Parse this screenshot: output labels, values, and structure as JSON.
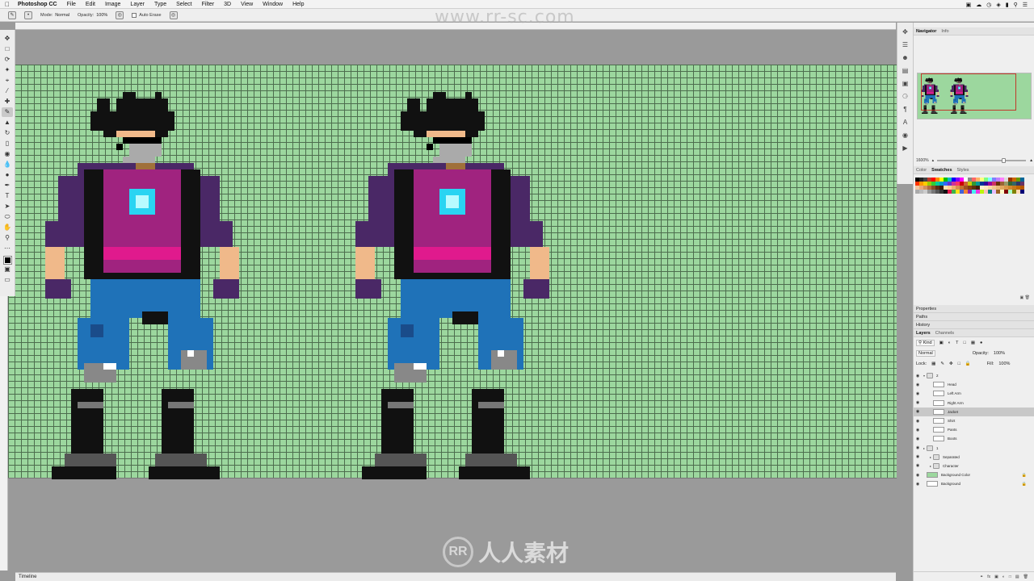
{
  "menubar": {
    "app_name": "Photoshop CC",
    "items": [
      "File",
      "Edit",
      "Image",
      "Layer",
      "Type",
      "Select",
      "Filter",
      "3D",
      "View",
      "Window",
      "Help"
    ]
  },
  "optionsbar": {
    "mode_label": "Mode:",
    "mode_value": "Normal",
    "opacity_label": "Opacity:",
    "opacity_value": "100%",
    "auto_erase_label": "Auto Erase"
  },
  "watermark": {
    "url": "www.rr-sc.com",
    "logo_text": "人人素材"
  },
  "timeline": {
    "label": "Timeline"
  },
  "navigator": {
    "tabs": [
      "Navigator",
      "Info"
    ],
    "zoom_value": "1600%"
  },
  "color_panel": {
    "tabs": [
      "Color",
      "Swatches",
      "Styles"
    ],
    "swatches": [
      "#000000",
      "#222222",
      "#444444",
      "#c0392b",
      "#ff0000",
      "#ff8800",
      "#ffff00",
      "#00c000",
      "#00c0c0",
      "#0000ff",
      "#8000ff",
      "#ff00ff",
      "#ffffff",
      "#888888",
      "#ff6666",
      "#ffb366",
      "#ffff80",
      "#80ff80",
      "#80ffff",
      "#8080ff",
      "#c080ff",
      "#ff80ff",
      "#dddddd",
      "#993300",
      "#cc6600",
      "#669900",
      "#006699",
      "#ff3300",
      "#ff9900",
      "#ffcc00",
      "#99cc00",
      "#33cc33",
      "#00cc99",
      "#0099cc",
      "#3366ff",
      "#6633cc",
      "#cc3399",
      "#ff3366",
      "#cc0000",
      "#cc6633",
      "#cccc00",
      "#339933",
      "#009999",
      "#003399",
      "#330099",
      "#990099",
      "#cc3366",
      "#663300",
      "#996633",
      "#999966",
      "#336633",
      "#336666",
      "#333366",
      "#663366",
      "#f2c6a0",
      "#e8a87c",
      "#d2905f",
      "#b36b3e",
      "#8a4a26",
      "#5c2e14",
      "#3b1a08",
      "#ffe0b0",
      "#ffd090",
      "#f0b070",
      "#d89050",
      "#c07030",
      "#a05020",
      "#804010",
      "#603010",
      "#402008",
      "#fff0d0",
      "#ffe8c0",
      "#f8d8a8",
      "#f0c890",
      "#e8b878",
      "#e0a860",
      "#d89848",
      "#d08830",
      "#c87818",
      "#c06800",
      "#b85800",
      "#aaaaaa",
      "#bbbbbb",
      "#cccccc",
      "#999999",
      "#777777",
      "#555555",
      "#333333",
      "#111111",
      "#e6194b",
      "#3cb44b",
      "#ffe119",
      "#4363d8",
      "#f58231",
      "#911eb4",
      "#46f0f0",
      "#f032e6",
      "#bcf60c",
      "#fabebe",
      "#008080",
      "#e6beff",
      "#9a6324",
      "#fffac8",
      "#800000",
      "#aaffc3",
      "#808000",
      "#ffd8b1",
      "#000075"
    ]
  },
  "collapsed_panels": [
    "Properties",
    "Paths",
    "History"
  ],
  "layers_panel": {
    "tabs": [
      "Layers",
      "Channels"
    ],
    "kind_label": "Kind",
    "blend_mode": "Normal",
    "opacity_label": "Opacity:",
    "opacity_value": "100%",
    "lock_label": "Lock:",
    "fill_label": "Fill:",
    "fill_value": "100%",
    "layers": [
      {
        "name": "2",
        "type": "group",
        "indent": 0,
        "expanded": true,
        "selected": false,
        "locked": false
      },
      {
        "name": "Head",
        "type": "layer",
        "indent": 1,
        "selected": false,
        "locked": false
      },
      {
        "name": "Left Arm",
        "type": "layer",
        "indent": 1,
        "selected": false,
        "locked": false
      },
      {
        "name": "Right Arm",
        "type": "layer",
        "indent": 1,
        "selected": false,
        "locked": false
      },
      {
        "name": "Jacket",
        "type": "layer",
        "indent": 1,
        "selected": true,
        "locked": false
      },
      {
        "name": "Shirt",
        "type": "layer",
        "indent": 1,
        "selected": false,
        "locked": false
      },
      {
        "name": "Pants",
        "type": "layer",
        "indent": 1,
        "selected": false,
        "locked": false
      },
      {
        "name": "Boots",
        "type": "layer",
        "indent": 1,
        "selected": false,
        "locked": false
      },
      {
        "name": "1",
        "type": "group",
        "indent": 0,
        "expanded": false,
        "selected": false,
        "locked": false
      },
      {
        "name": "Separated",
        "type": "group",
        "indent": 1,
        "expanded": false,
        "selected": false,
        "locked": false
      },
      {
        "name": "Character",
        "type": "group",
        "indent": 1,
        "expanded": false,
        "selected": false,
        "locked": false
      },
      {
        "name": "Background Color",
        "type": "fill",
        "indent": 0,
        "selected": false,
        "locked": true
      },
      {
        "name": "Background",
        "type": "layer",
        "indent": 0,
        "selected": false,
        "locked": true
      }
    ]
  },
  "colors": {
    "canvas_green": "#9cd79e",
    "grid_line": "#4d6d4e",
    "pasteboard": "#9a9a9a",
    "jacket_purple": "#4a2866",
    "shirt_magenta": "#a0237f",
    "pants_blue": "#1f72b8",
    "skin": "#f0b98a",
    "hair": "#111111"
  }
}
